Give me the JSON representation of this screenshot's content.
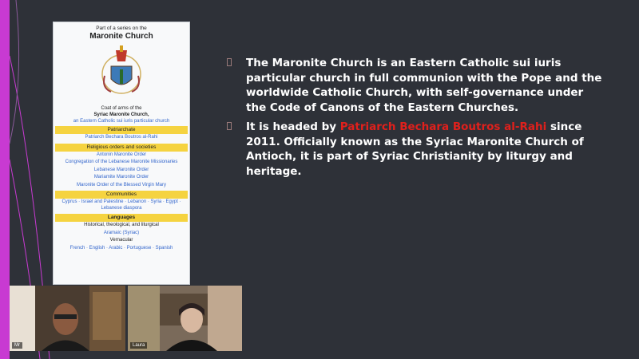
{
  "infobox": {
    "series": "Part of a series on the",
    "title": "Maronite Church",
    "caption_line1": "Coat of arms of the",
    "caption_line2": "Syriac Maronite Church,",
    "caption_line3": "an Eastern Catholic sui iuris particular church",
    "sections": [
      {
        "heading": "Patriarchate",
        "items": [
          {
            "text": "Patriarch Bechara Boutros al-Rahi",
            "link": true
          }
        ]
      },
      {
        "heading": "Religious orders and societies",
        "items": [
          {
            "text": "Antonin Maronite Order",
            "link": true
          },
          {
            "text": "Congregation of the Lebanese Maronite Missionaries",
            "link": true
          },
          {
            "text": "Lebanese Maronite Order",
            "link": true
          },
          {
            "text": "Mariamite Maronite Order",
            "link": true
          },
          {
            "text": "Maronite Order of the Blessed Virgin Mary",
            "link": true
          }
        ]
      },
      {
        "heading": "Communities",
        "items": [
          {
            "text": "Cyprus · Israel and Palestine · Lebanon · Syria · Egypt · Lebanese diaspora",
            "link": true
          }
        ]
      },
      {
        "heading": "Languages",
        "items": [
          {
            "text": "Historical, theological, and liturgical",
            "link": false
          },
          {
            "text": "Aramaic (Syriac)",
            "link": true
          },
          {
            "text": "Vernacular",
            "link": false
          },
          {
            "text": "French · English · Arabic · Portuguese · Spanish",
            "link": true
          }
        ]
      }
    ]
  },
  "bullets": {
    "b1": "The Maronite Church is an Eastern Catholic sui iuris particular church in full communion with the Pope and the worldwide Catholic Church, with self-governance under the Code of Canons of the Eastern Churches.",
    "b2_pre": "It is headed by ",
    "b2_highlight": "Patriarch Bechara Boutros al-Rahi",
    "b2_post": " since 2011. Officially known as the Syriac Maronite Church of Antioch, it is part of Syriac Christianity by liturgy and heritage."
  },
  "participants": [
    {
      "name": "Mr"
    },
    {
      "name": "Laura"
    }
  ],
  "colors": {
    "background": "#2e3138",
    "accent": "#c83ad2",
    "highlight": "#e0201c",
    "infobox_header": "#f5d340"
  }
}
